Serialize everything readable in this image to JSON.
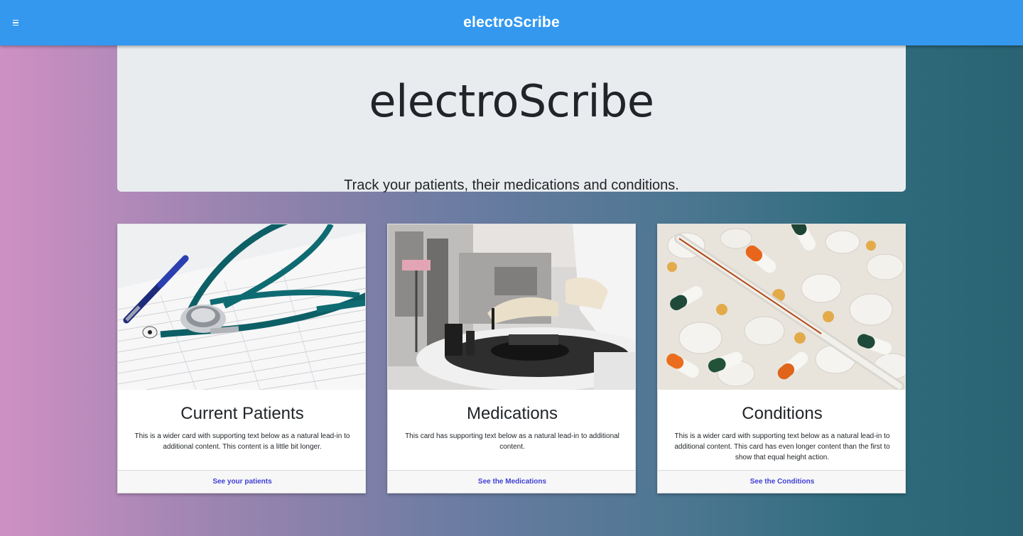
{
  "navbar": {
    "brand": "electroScribe",
    "menu_icon": "hamburger-icon",
    "bg_color": "#3498ef"
  },
  "hero": {
    "title": "electroScribe",
    "subtitle": "Track your patients, their medications and conditions."
  },
  "cards": [
    {
      "title": "Current Patients",
      "text": "This is a wider card with supporting text below as a natural lead-in to additional content. This content is a little bit longer.",
      "link": "See your patients",
      "image": "stethoscope-photo"
    },
    {
      "title": "Medications",
      "text": "This card has supporting text below as a natural lead-in to additional content.",
      "link": "See the Medications",
      "image": "laboratory-photo"
    },
    {
      "title": "Conditions",
      "text": "This is a wider card with supporting text below as a natural lead-in to additional content. This card has even longer content than the first to show that equal height action.",
      "link": "See the Conditions",
      "image": "pills-thermometer-photo"
    }
  ],
  "colors": {
    "link": "#3f3fd6",
    "hero_bg": "#e9ecef"
  }
}
